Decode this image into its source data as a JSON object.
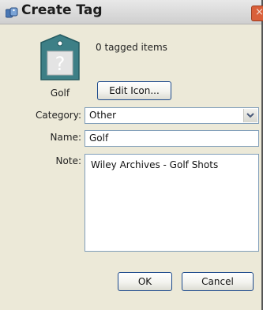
{
  "window": {
    "title": "Create Tag",
    "close_glyph": "×",
    "app_icon": "tags-app-icon"
  },
  "tag": {
    "icon": "question-mark-tag-icon",
    "icon_glyph": "?",
    "caption": "Golf",
    "count_text": "0 tagged items"
  },
  "buttons": {
    "edit_icon": "Edit Icon...",
    "ok": "OK",
    "cancel": "Cancel"
  },
  "form": {
    "category_label": "Category:",
    "category_value": "Other",
    "name_label": "Name:",
    "name_value": "Golf",
    "note_label": "Note:",
    "note_value": "Wiley Archives - Golf Shots"
  },
  "colors": {
    "window_bg": "#ece9d8",
    "button_border": "#1d4a8c",
    "field_border": "#7f9db9",
    "tag_teal": "#3d7f86"
  }
}
